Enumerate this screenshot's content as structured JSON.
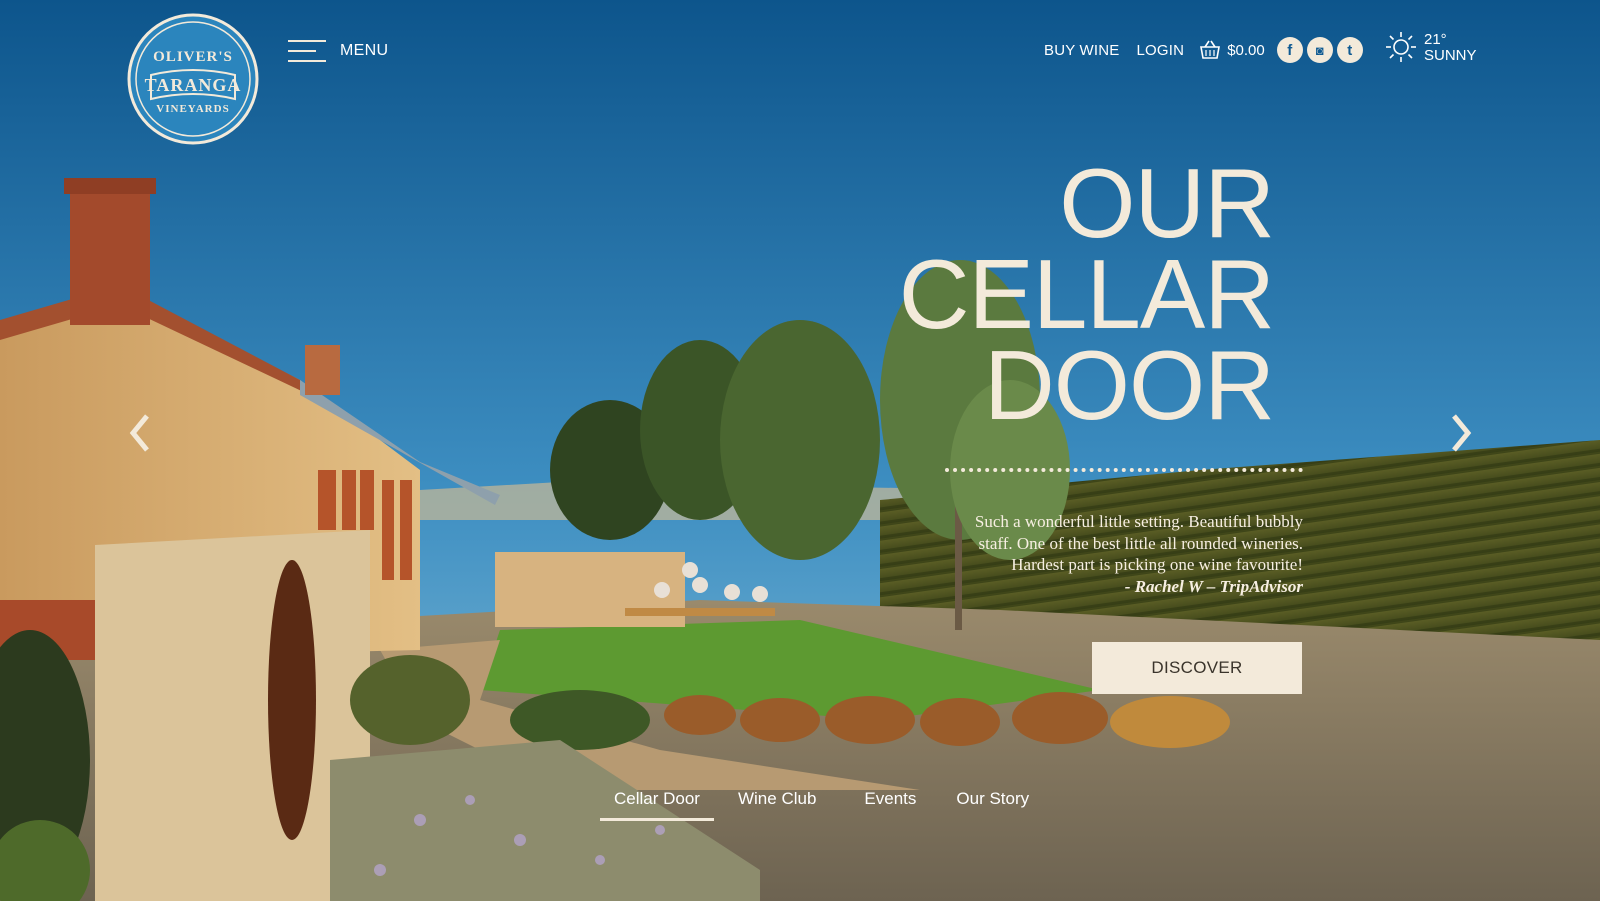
{
  "logo": {
    "line1": "OLIVER'S",
    "line2": "TARANGA",
    "line3": "VINEYARDS"
  },
  "menu": {
    "label": "MENU"
  },
  "topnav": {
    "buy_wine": "BUY WINE",
    "login": "LOGIN",
    "cart_total": "$0.00",
    "social": [
      {
        "icon": "facebook-icon",
        "glyph": "f"
      },
      {
        "icon": "instagram-icon",
        "glyph": "◙"
      },
      {
        "icon": "twitter-icon",
        "glyph": "t"
      }
    ]
  },
  "weather": {
    "temp": "21°",
    "condition": "SUNNY"
  },
  "hero": {
    "title_lines": [
      "OUR",
      "CELLAR",
      "DOOR"
    ],
    "quote_lines": [
      "Such a wonderful little setting. Beautiful bubbly",
      "staff. One of the best little all rounded wineries.",
      "Hardest part is picking one wine favourite!"
    ],
    "quote_author": "- Rachel W – TripAdvisor",
    "cta": "DISCOVER"
  },
  "subnav": {
    "items": [
      "Cellar Door",
      "Wine Club",
      "Events",
      "Our Story"
    ],
    "active": "Cellar Door"
  },
  "colors": {
    "accent_cream": "#f3eada",
    "sky_top": "#0f5a92",
    "sky_bottom": "#5fa8cf"
  }
}
